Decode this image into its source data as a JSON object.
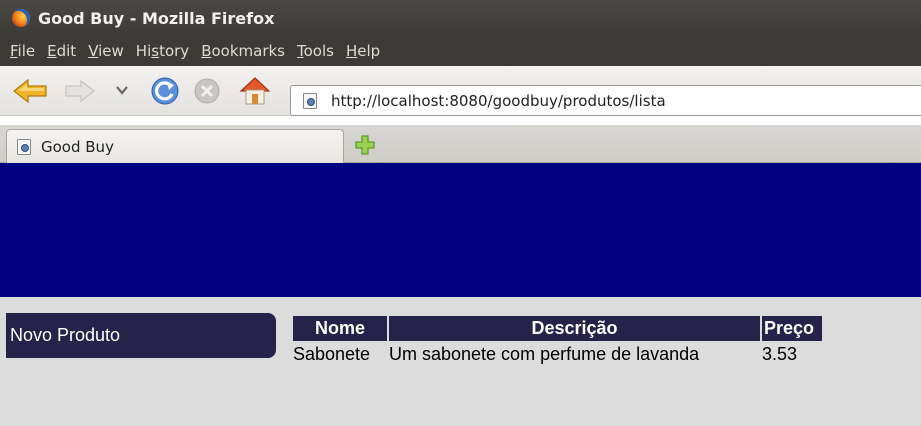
{
  "window": {
    "title": "Good Buy - Mozilla Firefox"
  },
  "menu": {
    "items": [
      {
        "u": "F",
        "rest": "ile"
      },
      {
        "u": "E",
        "rest": "dit"
      },
      {
        "u": "V",
        "rest": "iew"
      },
      {
        "pre": "Hi",
        "u": "s",
        "rest": "tory"
      },
      {
        "u": "B",
        "rest": "ookmarks"
      },
      {
        "u": "T",
        "rest": "ools"
      },
      {
        "u": "H",
        "rest": "elp"
      }
    ]
  },
  "toolbar": {
    "url": "http://localhost:8080/goodbuy/produtos/lista"
  },
  "tabs": [
    {
      "label": "Good Buy"
    }
  ],
  "page": {
    "side_link": "Novo Produto",
    "table": {
      "headers": [
        "Nome",
        "Descrição",
        "Preço"
      ],
      "rows": [
        [
          "Sabonete",
          "Um sabonete com perfume de lavanda",
          "3.53"
        ]
      ]
    }
  },
  "colors": {
    "banner": "#000080",
    "accent": "#25234a",
    "page_bg": "#dcdcdd"
  },
  "icons": [
    "firefox-logo-icon",
    "back-icon",
    "forward-icon",
    "history-dropdown-icon",
    "reload-icon",
    "stop-icon",
    "home-icon",
    "page-icon",
    "new-tab-icon"
  ]
}
